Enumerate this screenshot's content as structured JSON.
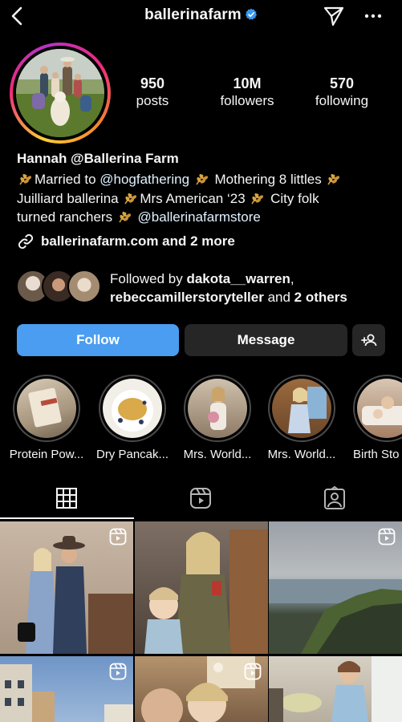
{
  "header": {
    "username": "ballerinafarm",
    "verified_color": "#3897f0"
  },
  "profile": {
    "stats": [
      {
        "value": "950",
        "label": "posts"
      },
      {
        "value": "10M",
        "label": "followers"
      },
      {
        "value": "570",
        "label": "following"
      }
    ],
    "display_name": "Hannah @Ballerina Farm",
    "bio": {
      "l1_a": "Married to ",
      "l1_mention": "@hogfathering",
      "l1_b": " Mothering 8 littles ",
      "l2_a": "Juilliard ballerina ",
      "l2_b": "Mrs American ‘23 ",
      "l2_c": " City folk",
      "l3_a": "turned ranchers ",
      "l3_mention": "@ballerinafarmstore"
    },
    "link_text": "ballerinafarm.com and 2 more",
    "followed_by": {
      "prefix": "Followed by ",
      "user1": "dakota__warren",
      "comma": ",",
      "user2": "rebeccamillerstoryteller",
      "mid": " and ",
      "others": "2 others"
    }
  },
  "buttons": {
    "follow": "Follow",
    "message": "Message"
  },
  "highlights": [
    {
      "label": "Protein Pow..."
    },
    {
      "label": "Dry Pancak..."
    },
    {
      "label": "Mrs. World..."
    },
    {
      "label": "Mrs. World..."
    },
    {
      "label": "Birth Sto"
    }
  ],
  "tabs": [
    "grid-icon",
    "reels-icon",
    "tagged-icon"
  ],
  "colors": {
    "follow_button": "#4a9df0",
    "secondary_button": "#262626",
    "background": "#000000"
  }
}
